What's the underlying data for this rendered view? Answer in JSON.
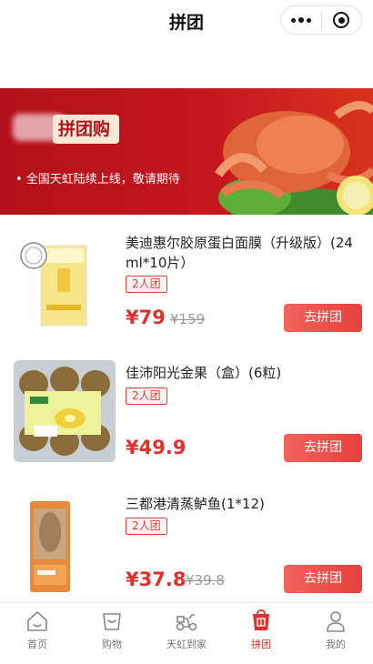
{
  "header": {
    "title": "拼团"
  },
  "banner": {
    "tag": "拼团购",
    "subtitle": "• 全国天虹陆续上线，敬请期待"
  },
  "products": [
    {
      "title": "美迪惠尔胶原蛋白面膜（升级版）(24 ml*10片）",
      "badge": "2人团",
      "price": "¥79",
      "original_price": "¥159",
      "button": "去拼团"
    },
    {
      "title": "佳沛阳光金果（盒）(6粒)",
      "badge": "2人团",
      "price": "¥49.9",
      "original_price": "",
      "button": "去拼团"
    },
    {
      "title": "三都港清蒸鲈鱼(1*12)",
      "badge": "2人团",
      "price": "¥37.8",
      "original_price": "¥39.8",
      "button": "去拼团"
    }
  ],
  "tabbar": {
    "items": [
      {
        "label": "首页",
        "icon": "home-icon"
      },
      {
        "label": "购物",
        "icon": "shopping-bag-icon"
      },
      {
        "label": "天虹到家",
        "icon": "delivery-scooter-icon"
      },
      {
        "label": "拼团",
        "icon": "group-buy-icon"
      },
      {
        "label": "我的",
        "icon": "user-icon"
      }
    ],
    "active": "拼团"
  },
  "colors": {
    "brand_red": "#e0302b",
    "banner_red": "#c4161e",
    "button_gradient_start": "#f2645b"
  }
}
